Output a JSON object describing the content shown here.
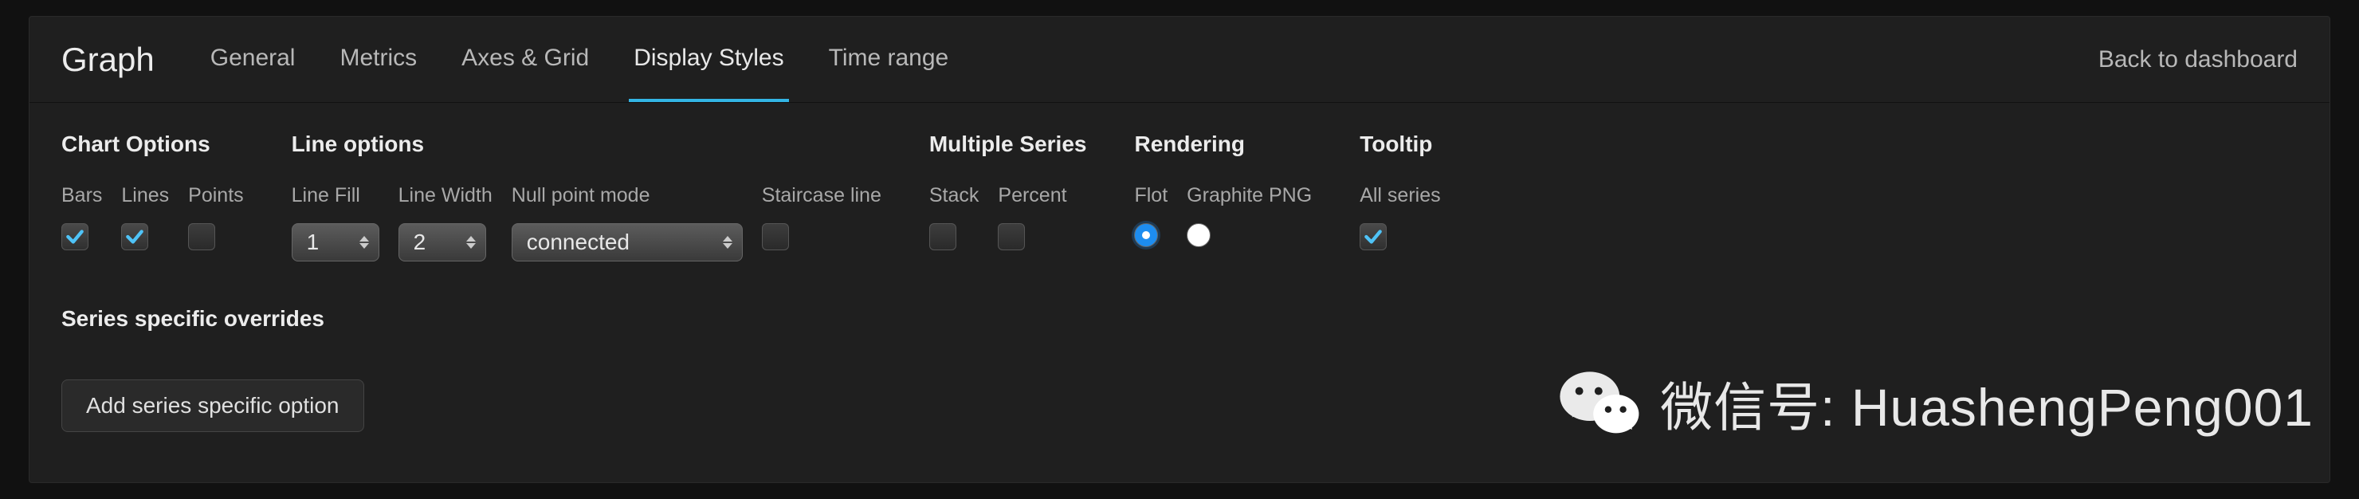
{
  "header": {
    "title": "Graph",
    "tabs": [
      {
        "label": "General",
        "active": false
      },
      {
        "label": "Metrics",
        "active": false
      },
      {
        "label": "Axes & Grid",
        "active": false
      },
      {
        "label": "Display Styles",
        "active": true
      },
      {
        "label": "Time range",
        "active": false
      }
    ],
    "back_label": "Back to dashboard"
  },
  "groups": {
    "chart_options": {
      "title": "Chart Options",
      "bars": {
        "label": "Bars",
        "checked": true
      },
      "lines": {
        "label": "Lines",
        "checked": true
      },
      "points": {
        "label": "Points",
        "checked": false
      }
    },
    "line_options": {
      "title": "Line options",
      "line_fill": {
        "label": "Line Fill",
        "value": "1"
      },
      "line_width": {
        "label": "Line Width",
        "value": "2"
      },
      "null_mode": {
        "label": "Null point mode",
        "value": "connected"
      },
      "staircase": {
        "label": "Staircase line",
        "checked": false
      }
    },
    "multiple_series": {
      "title": "Multiple Series",
      "stack": {
        "label": "Stack",
        "checked": false
      },
      "percent": {
        "label": "Percent",
        "checked": false
      }
    },
    "rendering": {
      "title": "Rendering",
      "flot": {
        "label": "Flot",
        "selected": true
      },
      "graphite_png": {
        "label": "Graphite PNG",
        "selected": false
      }
    },
    "tooltip": {
      "title": "Tooltip",
      "all_series": {
        "label": "All series",
        "checked": true
      }
    }
  },
  "overrides": {
    "title": "Series specific overrides",
    "add_button": "Add series specific option"
  },
  "watermark": {
    "text": "微信号: HuashengPeng001",
    "icon_name": "wechat-icon"
  }
}
